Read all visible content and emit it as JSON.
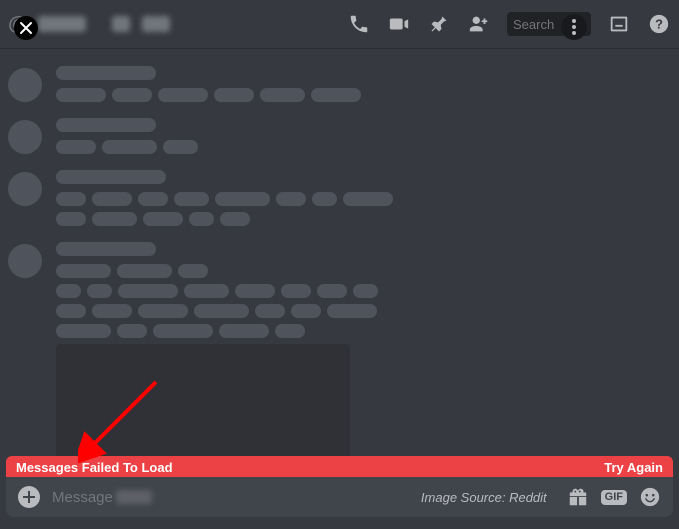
{
  "header": {
    "search_placeholder": "Search"
  },
  "error": {
    "message": "Messages Failed To Load",
    "retry_label": "Try Again"
  },
  "input": {
    "placeholder": "Message",
    "source_note": "Image Source: Reddit",
    "gif_label": "GIF"
  },
  "colors": {
    "error_bg": "#ed4245",
    "bg": "#36393f",
    "input_bg": "#40444b"
  }
}
